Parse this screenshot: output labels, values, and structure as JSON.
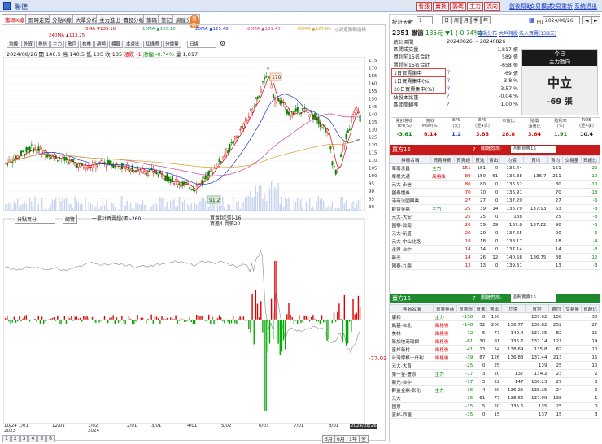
{
  "window": {
    "title": "聯德"
  },
  "toplinks": {
    "buy": "看漲",
    "sell": "賣換",
    "alert": "籌碼",
    "main": "主力",
    "flow": "流向",
    "help": "盤後幫助",
    "mode": "交易模式",
    "reset": "交易重新",
    "quit": "系統退出"
  },
  "tabs": [
    "籌碼K線",
    "即時走勢",
    "分點K線",
    "大單分析",
    "主力進出",
    "價股分析",
    "籌碼",
    "筆記",
    "房屋分析"
  ],
  "tab_badge": "更新",
  "ma": {
    "ma5": "5MA ▼139.10",
    "ma10": "10MA ▲135.10",
    "ma20": "20MA ▲125.48",
    "ma60": "60MA ▲131.45",
    "ma80": "80MA ▲127.60",
    "ma240": "240MA ▲113.25",
    "note": "◎設定籌碼指標"
  },
  "chart_toolbar": [
    "均線",
    "外資",
    "投信",
    "主力",
    "散戶",
    "布林",
    "趨勢",
    "標籤",
    "本益比",
    "紅綠燈",
    "分價量"
  ],
  "period": "日線",
  "quote_line": {
    "date": "2024/08/26",
    "open": "開 140.5",
    "high": "高 140.5",
    "low": "低 135",
    "close": "收 135",
    "chg": "漲跌 -1",
    "pct": "漲幅 -0.74%",
    "vol": "量 1,817"
  },
  "price_axis": [
    "175",
    "170",
    "165",
    "160",
    "155",
    "150",
    "145",
    "140",
    "135",
    "130",
    "125",
    "120",
    "115",
    "110",
    "105",
    "100",
    "95",
    "90",
    "85",
    "80"
  ],
  "peak_label": "170",
  "trough_label": "91.2",
  "sub_select": "分點買分",
  "sub_btn": "總覽",
  "sub_legend": {
    "a": "一累計買賣超(張)-260",
    "b": "買賣超(張)-16",
    "c": "買進4 賣張20"
  },
  "sub_value": "-77.03",
  "x_labels": [
    "10/24 1/01\n2023",
    "12/01",
    "1/02\n2024",
    "2/01",
    "3/01",
    "4/01",
    "5/02",
    "6/03",
    "7/01",
    "8/01",
    "2024/08/26"
  ],
  "bottom_tabs": [
    "1",
    "2",
    "3",
    "4",
    "5",
    "6"
  ],
  "zoom_btns": [
    "3月",
    "6月",
    "1年",
    "全"
  ],
  "right": {
    "stat_days_label": "統計天數",
    "stat_days": "1",
    "period_btns": [
      "日",
      "周",
      "月",
      "季",
      "年"
    ],
    "date_label": "日期",
    "date": "2024/08/26",
    "stock_line": "2351 聯德",
    "price": "135元",
    "chg": "▼1 (-0.74%)",
    "links": [
      "籌碼分布",
      "大戶持股",
      "法人買賣(138天)"
    ],
    "stats": [
      [
        "統計區間",
        "20240826 ~ 20240826",
        ""
      ],
      [
        "區間成交量",
        "",
        "1,817 張"
      ],
      [
        "買超前15名合計",
        "",
        "589 張"
      ],
      [
        "賣超前15名合計",
        "",
        "-658 張"
      ],
      [
        "1日買賣集中",
        "?",
        "-69 張"
      ],
      [
        "1日買賣集中(%)",
        "?",
        "-3.8 %"
      ],
      [
        "20日買賣集中(%)",
        "?",
        "3.57 %"
      ],
      [
        "佔股本比重",
        "?",
        "-0.04 %"
      ],
      [
        "區間周轉率",
        "?",
        "1.00 %"
      ]
    ],
    "today_title": "今日",
    "force_title": "主力動向",
    "force_state": "中立",
    "force_val": "-69 張",
    "metrics_head": [
      "累計營收\nYoY(%)",
      "營收\nMoM(%)",
      "EPS\n(元)",
      "EPS\n(近4季)",
      "本益比",
      "殖價\n淨值比",
      "殖利率\n(%)",
      "ROE\n(近4季)"
    ],
    "metrics": [
      "-3.61",
      "6.14",
      "1.2",
      "3.85",
      "28.8",
      "3.64",
      "1.91",
      "10.4"
    ],
    "buy_title": "買方15",
    "buy_filter": "關鍵券商:",
    "buy_sel": "區間買賣15",
    "sell_title": "賣方15",
    "sell_filter": "關鍵券商:",
    "sell_sel": "區間賣賣15",
    "cols": [
      "券商名稱",
      "買賣券商",
      "買賣超",
      "買進",
      "賣出",
      "均價",
      "買均",
      "賣均",
      "交易量",
      "買超比"
    ],
    "buy_rows": [
      [
        "華南永昌",
        "主力",
        "151",
        "151",
        "0",
        "136.44",
        "",
        "151",
        "",
        "-22"
      ],
      [
        "摩根大通",
        "風格後",
        "89",
        "150",
        "61",
        "136.38",
        "136.7",
        "211",
        "",
        "-10"
      ],
      [
        "元大-永信",
        "",
        "80",
        "80",
        "0",
        "136.62",
        "",
        "80",
        "",
        "-10"
      ],
      [
        "國泰證券",
        "",
        "70",
        "70",
        "0",
        "136.91",
        "",
        "70",
        "",
        "-13"
      ],
      [
        "港商法國興業",
        "",
        "27",
        "27",
        "0",
        "137.29",
        "",
        "27",
        "",
        "-6"
      ],
      [
        "群益金鼎",
        "主力",
        "25",
        "39",
        "14",
        "136.79",
        "137.93",
        "53",
        "",
        "-3"
      ],
      [
        "元大-大安",
        "",
        "25",
        "25",
        "0",
        "138",
        "",
        "25",
        "",
        "-8"
      ],
      [
        "國泰-敦南",
        "",
        "20",
        "59",
        "39",
        "137.8",
        "137.82",
        "98",
        "",
        "-5"
      ],
      [
        "元大-新盛",
        "",
        "20",
        "20",
        "0",
        "137.65",
        "",
        "20",
        "",
        "-5"
      ],
      [
        "元大-中山北路",
        "",
        "18",
        "18",
        "0",
        "138.17",
        "",
        "18",
        "",
        "-4"
      ],
      [
        "永興-台中",
        "",
        "14",
        "14",
        "0",
        "137.14",
        "",
        "14",
        "",
        "-3"
      ],
      [
        "新光",
        "",
        "14",
        "26",
        "12",
        "140.58",
        "136.75",
        "38",
        "",
        "-12"
      ],
      [
        "國泰-九鼎",
        "",
        "13",
        "13",
        "0",
        "139.31",
        "",
        "13",
        "",
        "-3"
      ]
    ],
    "sell_rows": [
      [
        "康和",
        "主力",
        "-150",
        "0",
        "150",
        "",
        "137.02",
        "150",
        "",
        "30"
      ],
      [
        "凱基-台北",
        "風格後",
        "-148",
        "52",
        "200",
        "136.77",
        "136.82",
        "252",
        "",
        "27"
      ],
      [
        "美林",
        "風格後",
        "-72",
        "5",
        "77",
        "140.4",
        "137.35",
        "82",
        "",
        "15"
      ],
      [
        "新加坡商瑞銀",
        "風格後",
        "-61",
        "30",
        "91",
        "136.7",
        "137.14",
        "121",
        "",
        "14"
      ],
      [
        "富邦新村",
        "風格後",
        "-41",
        "13",
        "54",
        "138.69",
        "135.8",
        "67",
        "",
        "10"
      ],
      [
        "台灣摩根士丹利",
        "風格後",
        "-39",
        "87",
        "126",
        "136.83",
        "137.44",
        "213",
        "",
        "15"
      ],
      [
        "元大-大直",
        "",
        "-25",
        "0",
        "25",
        "",
        "139",
        "25",
        "",
        "10"
      ],
      [
        "第一金-豐原",
        "主力",
        "-17",
        "3",
        "20",
        "137",
        "134.2",
        "23",
        "",
        "2"
      ],
      [
        "新光-台中",
        "",
        "-17",
        "5",
        "22",
        "147",
        "136.23",
        "27",
        "",
        "3"
      ],
      [
        "群益金鼎-彰化",
        "主力",
        "-16",
        "4",
        "20",
        "136.25",
        "138.25",
        "24",
        "",
        "6"
      ],
      [
        "元大",
        "",
        "-16",
        "61",
        "77",
        "138.66",
        "137.99",
        "138",
        "",
        "1"
      ],
      [
        "國票",
        "",
        "-15",
        "5",
        "20",
        "135.6",
        "135",
        "25",
        "",
        "0"
      ],
      [
        "富邦-西壇",
        "",
        "-15",
        "0",
        "15",
        "",
        "137",
        "15",
        "",
        "3"
      ]
    ]
  }
}
